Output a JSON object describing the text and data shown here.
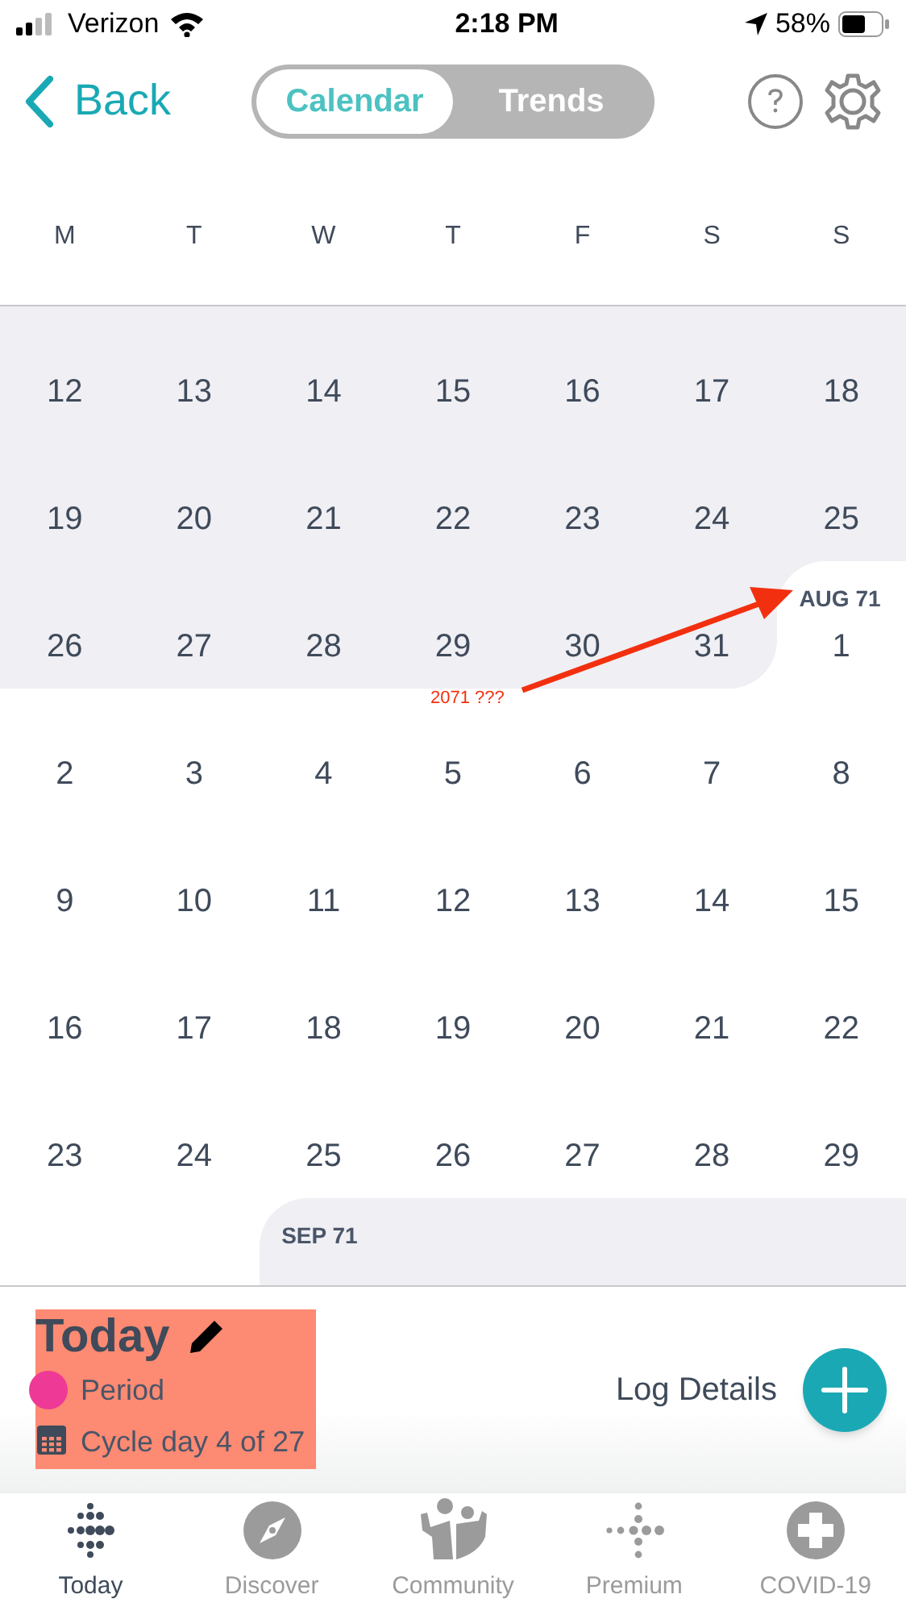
{
  "status_bar": {
    "carrier": "Verizon",
    "time": "2:18 PM",
    "battery": "58%"
  },
  "nav": {
    "back": "Back",
    "segments": [
      {
        "label": "Calendar",
        "selected": true
      },
      {
        "label": "Trends",
        "selected": false
      }
    ]
  },
  "weekdays": [
    "M",
    "T",
    "W",
    "T",
    "F",
    "S",
    "S"
  ],
  "weeks": [
    {
      "days": [
        {
          "label": "12",
          "shaded": true
        },
        {
          "label": "13",
          "shaded": true
        },
        {
          "label": "14",
          "shaded": true
        },
        {
          "label": "15",
          "shaded": true
        },
        {
          "label": "16",
          "shaded": true
        },
        {
          "label": "17",
          "shaded": true
        },
        {
          "label": "18",
          "shaded": true
        }
      ]
    },
    {
      "days": [
        {
          "label": "19",
          "shaded": true
        },
        {
          "label": "20",
          "shaded": true
        },
        {
          "label": "21",
          "shaded": true
        },
        {
          "label": "22",
          "shaded": true
        },
        {
          "label": "23",
          "shaded": true
        },
        {
          "label": "24",
          "shaded": true
        },
        {
          "label": "25",
          "shaded": true
        }
      ]
    },
    {
      "days": [
        {
          "label": "26",
          "shaded": true
        },
        {
          "label": "27",
          "shaded": true
        },
        {
          "label": "28",
          "shaded": true
        },
        {
          "label": "29",
          "shaded": true
        },
        {
          "label": "30",
          "shaded": true
        },
        {
          "label": "31",
          "shaded": true
        },
        {
          "label": "1",
          "shaded": false,
          "month_label": "AUG 71"
        }
      ]
    },
    {
      "days": [
        {
          "label": "2",
          "shaded": false
        },
        {
          "label": "3",
          "shaded": false
        },
        {
          "label": "4",
          "shaded": false
        },
        {
          "label": "5",
          "shaded": false
        },
        {
          "label": "6",
          "shaded": false
        },
        {
          "label": "7",
          "shaded": false
        },
        {
          "label": "8",
          "shaded": false
        }
      ]
    },
    {
      "days": [
        {
          "label": "9",
          "shaded": false
        },
        {
          "label": "10",
          "shaded": false
        },
        {
          "label": "11",
          "shaded": false
        },
        {
          "label": "12",
          "shaded": false
        },
        {
          "label": "13",
          "shaded": false
        },
        {
          "label": "14",
          "shaded": false
        },
        {
          "label": "15",
          "shaded": false
        }
      ]
    },
    {
      "days": [
        {
          "label": "16",
          "shaded": false
        },
        {
          "label": "17",
          "shaded": false
        },
        {
          "label": "18",
          "shaded": false
        },
        {
          "label": "19",
          "shaded": false
        },
        {
          "label": "20",
          "shaded": false
        },
        {
          "label": "21",
          "shaded": false
        },
        {
          "label": "22",
          "shaded": false
        }
      ]
    },
    {
      "days": [
        {
          "label": "23",
          "shaded": false
        },
        {
          "label": "24",
          "shaded": false
        },
        {
          "label": "25",
          "shaded": false
        },
        {
          "label": "26",
          "shaded": false
        },
        {
          "label": "27",
          "shaded": false
        },
        {
          "label": "28",
          "shaded": false
        },
        {
          "label": "29",
          "shaded": false
        }
      ]
    },
    {
      "days": [
        {
          "shaded": true,
          "month_label": "SEP 71"
        },
        {
          "shaded": true
        },
        {
          "shaded": true
        },
        {
          "shaded": true
        },
        {
          "shaded": true
        }
      ]
    }
  ],
  "annotation": {
    "text": "2071 ???"
  },
  "today": {
    "title": "Today",
    "legend": [
      {
        "kind": "dot",
        "label": "Period",
        "color": "#ee3a96"
      },
      {
        "kind": "calendar",
        "label": "Cycle day 4 of 27"
      }
    ],
    "log_label": "Log Details"
  },
  "tabs": [
    {
      "label": "Today",
      "kind": "dots",
      "selected": true
    },
    {
      "label": "Discover",
      "kind": "compass",
      "selected": false
    },
    {
      "label": "Community",
      "kind": "people",
      "selected": false
    },
    {
      "label": "Premium",
      "kind": "dots-line",
      "selected": false
    },
    {
      "label": "COVID-19",
      "kind": "cross",
      "selected": false
    }
  ]
}
